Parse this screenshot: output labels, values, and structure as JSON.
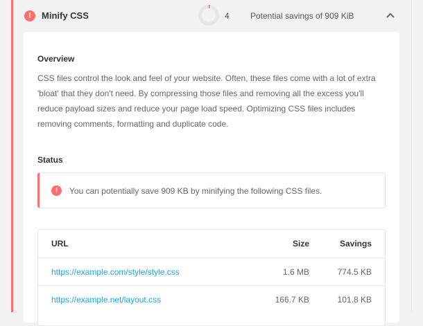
{
  "audit": {
    "title": "Minify CSS",
    "count": "4",
    "savings": "Potential savings of 909 KiB",
    "score_fraction": 0.02
  },
  "overview": {
    "heading": "Overview",
    "text": "CSS files control the look and feel of your website. Often, these files come with a lot of extra 'bloat' that they don't need. By compressing those files and removing all the excess you'll reduce payload sizes and reduce your page load speed. Optimizing CSS files includes removing comments, formatting and duplicate code."
  },
  "status": {
    "heading": "Status",
    "message": "You can potentially save 909 KB by minifying the following CSS files."
  },
  "table": {
    "headers": {
      "url": "URL",
      "size": "Size",
      "savings": "Savings"
    },
    "rows": [
      {
        "url": "https://example.com/style/style.css",
        "size": "1.6 MB",
        "savings": "774.5 KB"
      },
      {
        "url": "https://example.net/layout.css",
        "size": "166.7 KB",
        "savings": "101.8 KB"
      }
    ]
  },
  "colors": {
    "error": "#ff6d6d",
    "link": "#17a8e3",
    "ring_track": "#e6e6e6"
  },
  "icons": {
    "error": "exclamation-circle-icon",
    "collapse": "chevron-up-icon"
  }
}
